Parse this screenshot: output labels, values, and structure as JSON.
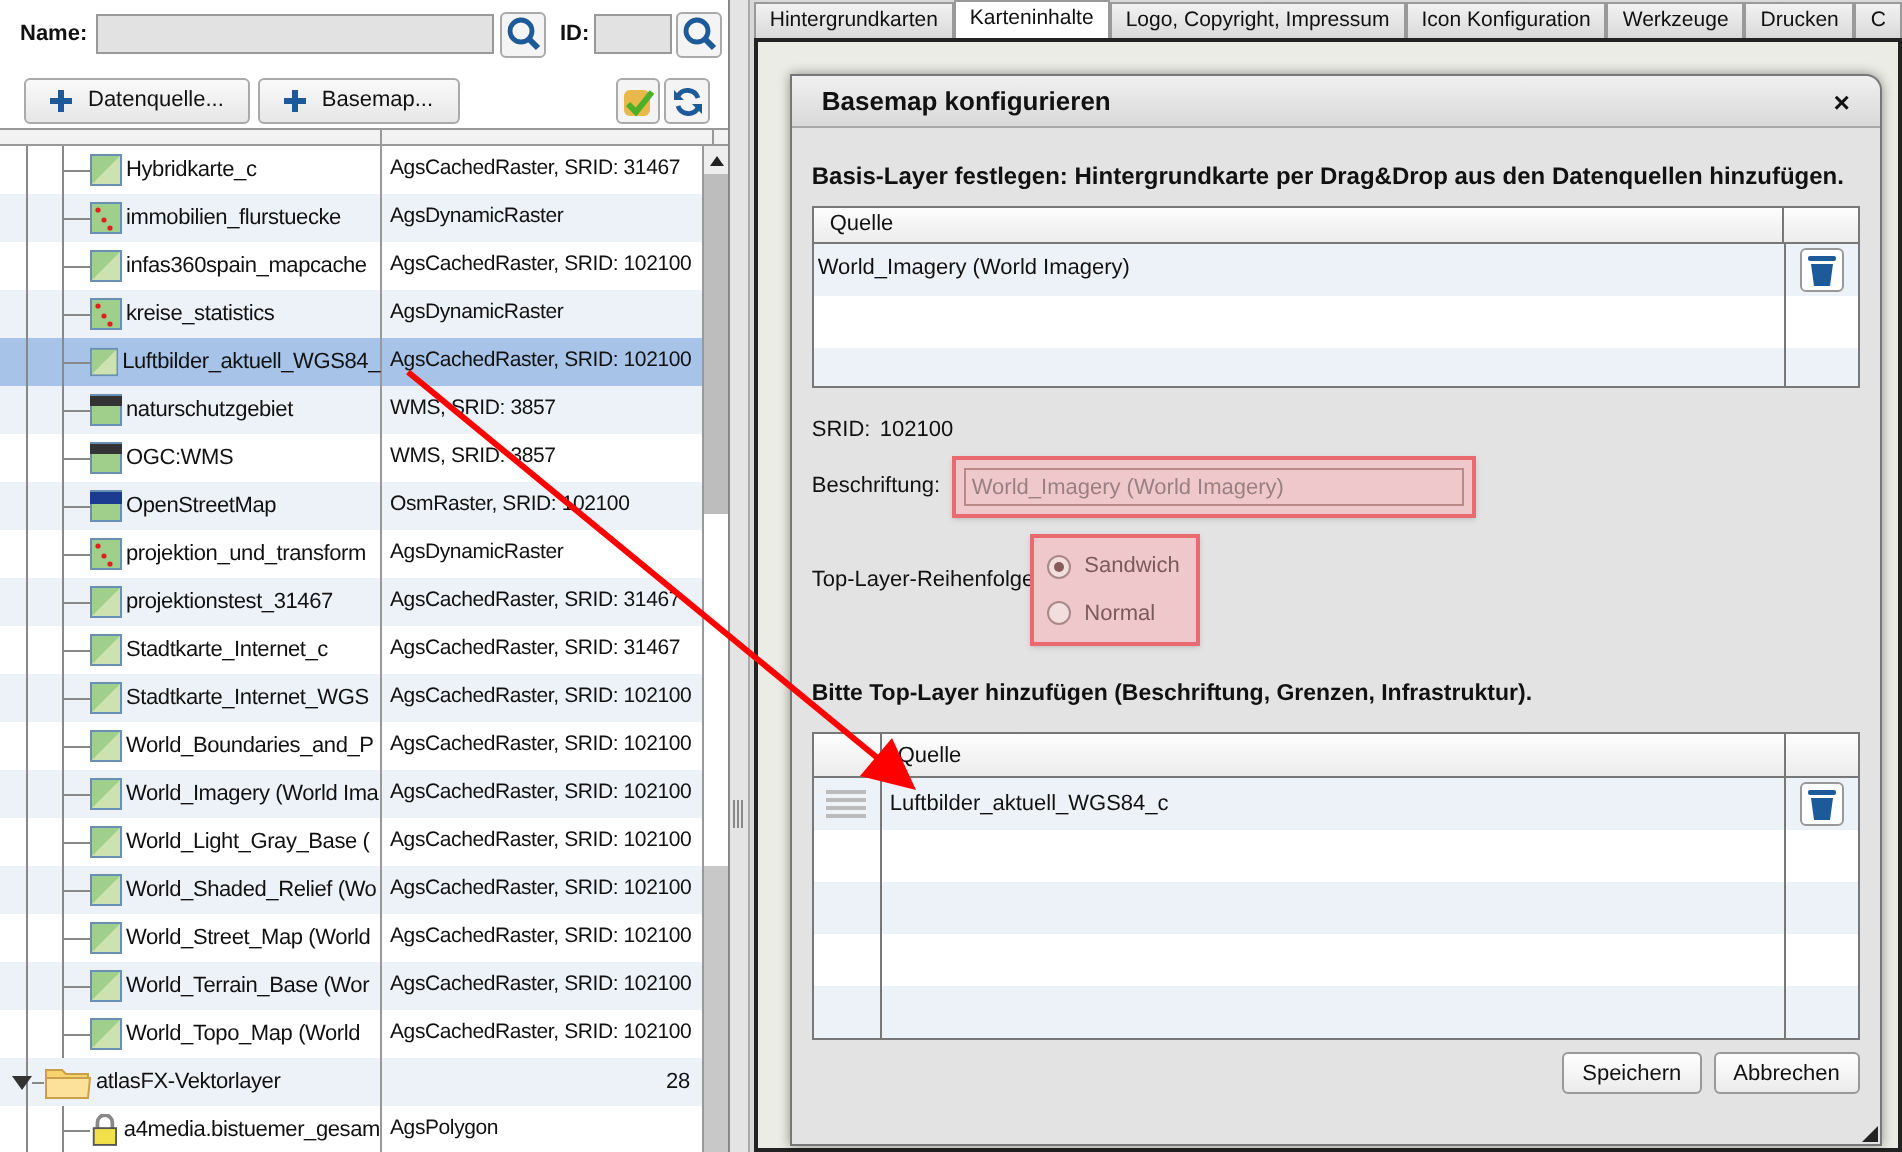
{
  "left_panel": {
    "name_label": "Name:",
    "id_label": "ID:",
    "buttons": [
      {
        "label": "Datenquelle..."
      },
      {
        "label": "Basemap..."
      }
    ]
  },
  "tree": {
    "continued_items": [
      {
        "kind": "raster",
        "name": "Hybridkarte_c",
        "type": "AgsCachedRaster, SRID: 31467",
        "selected": false
      },
      {
        "kind": "dynamic",
        "name": "immobilien_flurstuecke",
        "type": "AgsDynamicRaster",
        "selected": false
      },
      {
        "kind": "raster",
        "name": "infas360spain_mapcache",
        "type": "AgsCachedRaster, SRID: 102100",
        "selected": false
      },
      {
        "kind": "dynamic",
        "name": "kreise_statistics",
        "type": "AgsDynamicRaster",
        "selected": false
      },
      {
        "kind": "raster",
        "name": "Luftbilder_aktuell_WGS84_",
        "type": "AgsCachedRaster, SRID: 102100",
        "selected": true
      },
      {
        "kind": "wms",
        "name": "naturschutzgebiet",
        "type": "WMS, SRID: 3857",
        "selected": false
      },
      {
        "kind": "wms",
        "name": "OGC:WMS",
        "type": "WMS, SRID: 3857",
        "selected": false
      },
      {
        "kind": "osm",
        "name": "OpenStreetMap",
        "type": "OsmRaster, SRID: 102100",
        "selected": false
      },
      {
        "kind": "dynamic",
        "name": "projektion_und_transform",
        "type": "AgsDynamicRaster",
        "selected": false
      },
      {
        "kind": "raster",
        "name": "projektionstest_31467",
        "type": "AgsCachedRaster, SRID: 31467",
        "selected": false
      },
      {
        "kind": "raster",
        "name": "Stadtkarte_Internet_c",
        "type": "AgsCachedRaster, SRID: 31467",
        "selected": false
      },
      {
        "kind": "raster",
        "name": "Stadtkarte_Internet_WGS",
        "type": "AgsCachedRaster, SRID: 102100",
        "selected": false
      },
      {
        "kind": "raster",
        "name": "World_Boundaries_and_P",
        "type": "AgsCachedRaster, SRID: 102100",
        "selected": false
      },
      {
        "kind": "raster",
        "name": "World_Imagery (World Ima",
        "type": "AgsCachedRaster, SRID: 102100",
        "selected": false
      },
      {
        "kind": "raster",
        "name": "World_Light_Gray_Base (",
        "type": "AgsCachedRaster, SRID: 102100",
        "selected": false
      },
      {
        "kind": "raster",
        "name": "World_Shaded_Relief (Wo",
        "type": "AgsCachedRaster, SRID: 102100",
        "selected": false
      },
      {
        "kind": "raster",
        "name": "World_Street_Map (World",
        "type": "AgsCachedRaster, SRID: 102100",
        "selected": false
      },
      {
        "kind": "raster",
        "name": "World_Terrain_Base (Wor",
        "type": "AgsCachedRaster, SRID: 102100",
        "selected": false
      },
      {
        "kind": "raster",
        "name": "World_Topo_Map (World",
        "type": "AgsCachedRaster, SRID: 102100",
        "selected": false
      }
    ],
    "items": [
      {
        "kind": "folder",
        "name": "atlasFX-Vektorlayer",
        "count": "28",
        "expanded": true,
        "selected": false,
        "children": [
          {
            "kind": "vector",
            "name": "a4media.bistuemer_gesam",
            "type": "AgsPolygon",
            "selected": false
          }
        ]
      }
    ]
  },
  "tabs": [
    {
      "label": "Hintergrundkarten",
      "selected": false
    },
    {
      "label": "Karteninhalte",
      "selected": true
    },
    {
      "label": "Logo, Copyright, Impressum",
      "selected": false
    },
    {
      "label": "Icon Konfiguration",
      "selected": false
    },
    {
      "label": "Werkzeuge",
      "selected": false
    },
    {
      "label": "Drucken",
      "selected": false
    },
    {
      "label": "C",
      "selected": false
    }
  ],
  "dialog": {
    "title": "Basemap konfigurieren",
    "close": "×",
    "base_heading": "Basis-Layer festlegen: Hintergrundkarte per Drag&Drop aus den Datenquellen hinzufügen.",
    "base_table": {
      "columns": [
        "Quelle"
      ],
      "rows": [
        "World_Imagery (World Imagery)"
      ]
    },
    "srid_label": "SRID:",
    "srid": "102100",
    "caption_label": "Beschriftung:",
    "caption_value": "World_Imagery (World Imagery)",
    "caption_disabled": true,
    "order_label": "Top-Layer-Reihenfolge",
    "order_options": [
      {
        "label": "Sandwich",
        "selected": true
      },
      {
        "label": "Normal",
        "selected": false
      }
    ],
    "top_heading": "Bitte Top-Layer hinzufügen (Beschriftung, Grenzen, Infrastruktur).",
    "top_table": {
      "columns": [
        "Quelle"
      ],
      "rows": [
        "Luftbilder_aktuell_WGS84_c"
      ]
    },
    "buttons": [
      "Speichern",
      "Abbrechen"
    ]
  }
}
